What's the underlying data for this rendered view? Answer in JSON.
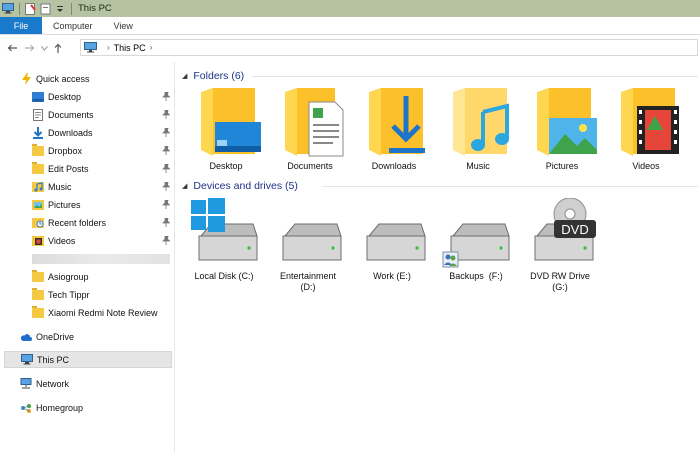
{
  "window": {
    "title": "This PC"
  },
  "ribbon": {
    "tabs": [
      "File",
      "Computer",
      "View"
    ]
  },
  "address": {
    "crumb": "This PC"
  },
  "nav": {
    "quick_access": "Quick access",
    "items": [
      {
        "label": "Desktop",
        "icon": "desktop-icon",
        "pinned": true
      },
      {
        "label": "Documents",
        "icon": "documents-icon",
        "pinned": true
      },
      {
        "label": "Downloads",
        "icon": "downloads-icon",
        "pinned": true
      },
      {
        "label": "Dropbox",
        "icon": "folder-icon",
        "pinned": true
      },
      {
        "label": "Edit Posts",
        "icon": "folder-icon",
        "pinned": true
      },
      {
        "label": "Music",
        "icon": "music-icon",
        "pinned": true
      },
      {
        "label": "Pictures",
        "icon": "pictures-icon",
        "pinned": true
      },
      {
        "label": "Recent folders",
        "icon": "recent-folders-icon",
        "pinned": true
      },
      {
        "label": "Videos",
        "icon": "videos-icon",
        "pinned": true
      },
      {
        "label": "Asiogroup",
        "icon": "folder-icon",
        "pinned": false
      },
      {
        "label": "Tech Tippr",
        "icon": "folder-icon",
        "pinned": false
      },
      {
        "label": "Xiaomi Redmi Note Review",
        "icon": "folder-icon",
        "pinned": false
      }
    ],
    "onedrive": "OneDrive",
    "this_pc": "This PC",
    "network": "Network",
    "homegroup": "Homegroup"
  },
  "folders": {
    "heading": "Folders (6)",
    "items": [
      "Desktop",
      "Documents",
      "Downloads",
      "Music",
      "Pictures",
      "Videos"
    ]
  },
  "drives": {
    "heading": "Devices and drives (5)",
    "items": [
      {
        "line1": "Local Disk (C:)",
        "line2": ""
      },
      {
        "line1": "Entertainment",
        "line2": "(D:)"
      },
      {
        "line1": "Work (E:)",
        "line2": ""
      },
      {
        "line1": "Backups  (F:)",
        "line2": ""
      },
      {
        "line1": "DVD RW Drive",
        "line2": "(G:)",
        "badge": "DVD"
      }
    ]
  },
  "colors": {
    "accent": "#1979ca",
    "group_heading": "#1e3287",
    "titlebar": "#b6c3a3",
    "folder": "#f5c842"
  }
}
